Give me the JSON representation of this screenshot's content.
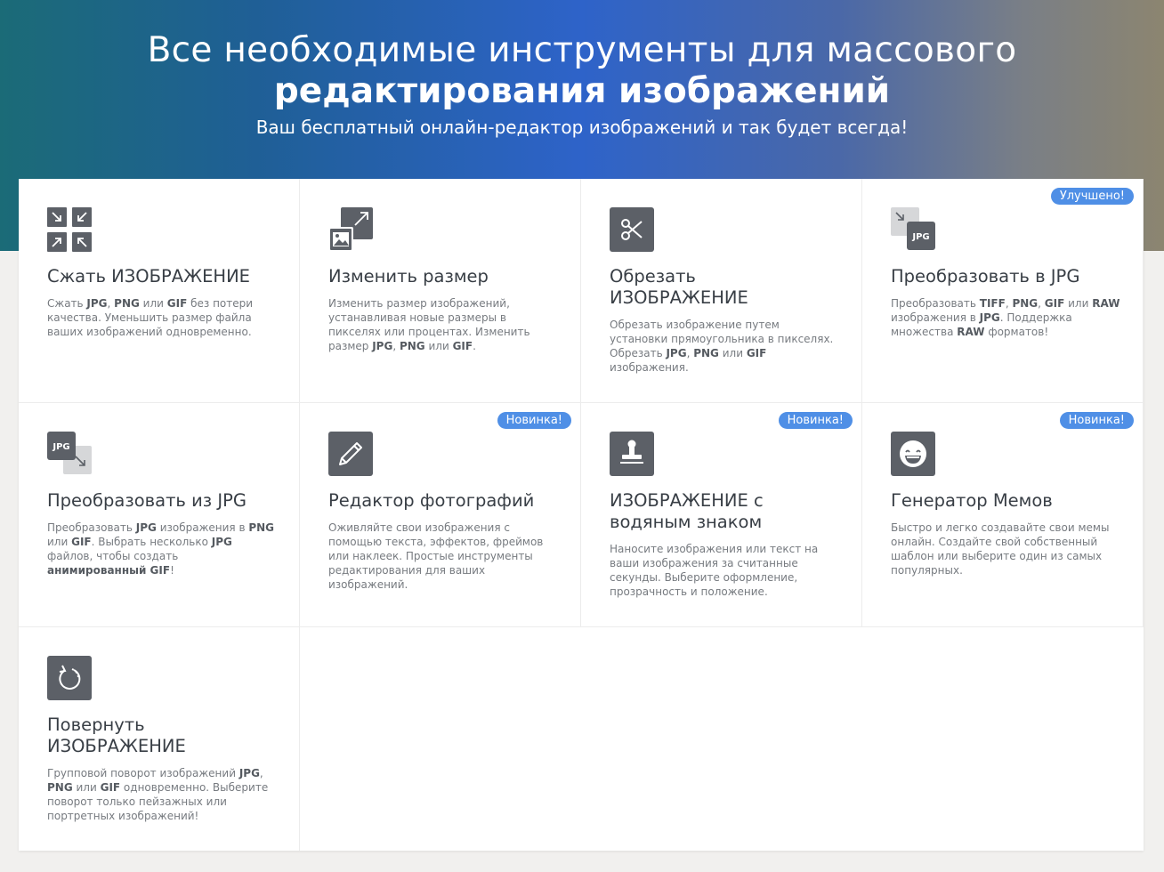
{
  "hero": {
    "title_line1": "Все необходимые инструменты для массового",
    "title_line2": "редактирования изображений",
    "subtitle": "Ваш бесплатный онлайн-редактор изображений и так будет всегда!"
  },
  "colors": {
    "hero_gradient": [
      "#1b6b77",
      "#2e63c9",
      "#8c8570"
    ],
    "badge": "#4f8fe6",
    "icon": "#5c6067"
  },
  "tools": [
    {
      "icon": "compress-icon",
      "title": "Сжать ИЗОБРАЖЕНИЕ",
      "desc": [
        "Сжать ",
        "JPG",
        ", ",
        "PNG",
        " или ",
        "GIF",
        " без потери качества. Уменьшить размер файла ваших изображений одновременно."
      ]
    },
    {
      "icon": "resize-icon",
      "title": "Изменить размер",
      "desc": [
        "Изменить размер изображений, устанавливая новые размеры в пикселях или процентах. Изменить размер ",
        "JPG",
        ", ",
        "PNG",
        " или ",
        "GIF",
        "."
      ]
    },
    {
      "icon": "scissors-icon",
      "title": "Обрезать ИЗОБРАЖЕНИЕ",
      "desc": [
        "Обрезать изображение путем установки прямоугольника в пикселях. Обрезать ",
        "JPG",
        ", ",
        "PNG",
        " или ",
        "GIF",
        " изображения."
      ]
    },
    {
      "icon": "convert-to-jpg-icon",
      "title": "Преобразовать в JPG",
      "badge": "Улучшено!",
      "icon_text": "JPG",
      "desc": [
        "Преобразовать ",
        "TIFF",
        ", ",
        "PNG",
        ", ",
        "GIF",
        " или ",
        "RAW",
        " изображения в ",
        "JPG",
        ". Поддержка множества ",
        "RAW",
        " форматов!"
      ]
    },
    {
      "icon": "convert-from-jpg-icon",
      "title": "Преобразовать из JPG",
      "icon_text": "JPG",
      "desc": [
        "Преобразовать ",
        "JPG",
        " изображения в ",
        "PNG",
        " или ",
        "GIF",
        ". Выбрать несколько ",
        "JPG",
        " файлов, чтобы создать ",
        "анимированный GIF",
        "!"
      ]
    },
    {
      "icon": "pencil-icon",
      "title": "Редактор фотографий",
      "badge": "Новинка!",
      "desc": [
        "Оживляйте свои изображения с помощью текста, эффектов, фреймов или наклеек. Простые инструменты редактирования для ваших изображений."
      ]
    },
    {
      "icon": "stamp-icon",
      "title": "ИЗОБРАЖЕНИЕ с водяным знаком",
      "badge": "Новинка!",
      "desc": [
        "Наносите изображения или текст на ваши изображения за считанные секунды. Выберите оформление, прозрачность и положение."
      ]
    },
    {
      "icon": "meme-face-icon",
      "title": "Генератор Мемов",
      "badge": "Новинка!",
      "desc": [
        "Быстро и легко создавайте свои мемы онлайн. Создайте свой собственный шаблон или выберите один из самых популярных."
      ]
    },
    {
      "icon": "rotate-icon",
      "title": "Повернуть ИЗОБРАЖЕНИЕ",
      "desc": [
        "Групповой поворот изображений ",
        "JPG",
        ", ",
        "PNG",
        " или ",
        "GIF",
        " одновременно. Выберите поворот только пейзажных или портретных изображений!"
      ]
    }
  ]
}
